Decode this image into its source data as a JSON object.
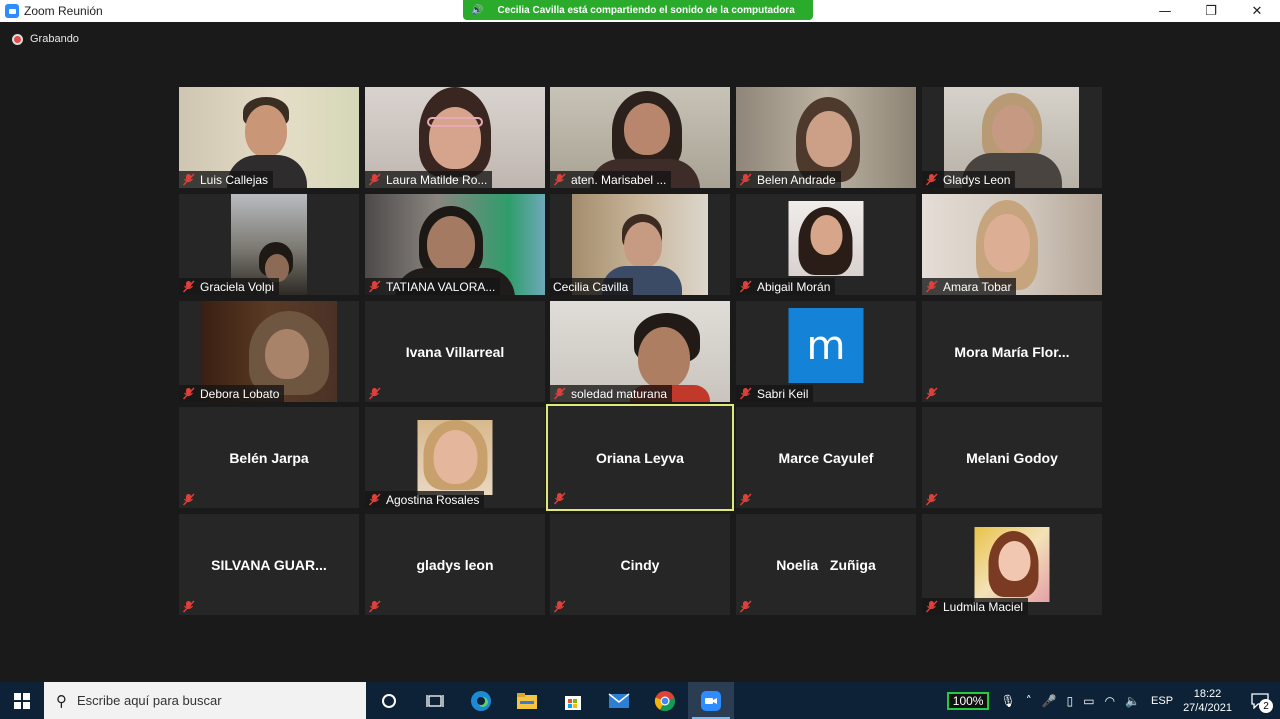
{
  "window": {
    "title": "Zoom Reunión"
  },
  "banner": {
    "text": "Cecilia Cavilla está compartiendo el sonido de la computadora"
  },
  "recording": {
    "label": "Grabando"
  },
  "participants": [
    {
      "name": "Luis Callejas",
      "video": true,
      "muted": true
    },
    {
      "name": "Laura Matilde Ro...",
      "video": true,
      "muted": true
    },
    {
      "name": "aten. Marisabel ...",
      "video": true,
      "muted": true
    },
    {
      "name": "Belen Andrade",
      "video": true,
      "muted": true
    },
    {
      "name": "Gladys Leon",
      "video": true,
      "muted": true
    },
    {
      "name": "Graciela Volpi",
      "video": true,
      "muted": true
    },
    {
      "name": "TATIANA VALORA...",
      "video": true,
      "muted": true
    },
    {
      "name": "Cecilia Cavilla",
      "video": true,
      "muted": false
    },
    {
      "name": "Abigail Morán",
      "video": false,
      "muted": true,
      "avatar": "photo"
    },
    {
      "name": "Amara Tobar",
      "video": true,
      "muted": true
    },
    {
      "name": "Debora Lobato",
      "video": true,
      "muted": true
    },
    {
      "name": "Ivana Villarreal",
      "video": false,
      "muted": true
    },
    {
      "name": "soledad maturana",
      "video": true,
      "muted": true
    },
    {
      "name": "Sabri Keil",
      "video": false,
      "muted": true,
      "avatar": "letter",
      "letter": "m"
    },
    {
      "name": "Mora  María Flor...",
      "video": false,
      "muted": true
    },
    {
      "name": "Belén Jarpa",
      "video": false,
      "muted": true
    },
    {
      "name": "Agostina Rosales",
      "video": false,
      "muted": true,
      "avatar": "photo"
    },
    {
      "name": "Oriana Leyva",
      "video": false,
      "muted": true,
      "active_speaker": true
    },
    {
      "name": "Marce Cayulef",
      "video": false,
      "muted": true
    },
    {
      "name": "Melani Godoy",
      "video": false,
      "muted": true
    },
    {
      "name": "SILVANA GUAR...",
      "video": false,
      "muted": true
    },
    {
      "name": "gladys leon",
      "video": false,
      "muted": true
    },
    {
      "name": "Cindy",
      "video": false,
      "muted": true
    },
    {
      "name": "Noelia   Zuñiga",
      "video": false,
      "muted": true
    },
    {
      "name": "Ludmila Maciel",
      "video": false,
      "muted": true,
      "avatar": "photo"
    }
  ],
  "taskbar": {
    "search_placeholder": "Escribe aquí para buscar",
    "battery": "100%",
    "language": "ESP",
    "time": "18:22",
    "date": "27/4/2021",
    "notifications": "2"
  },
  "colors": {
    "banner_green": "#2bab2b",
    "active_speaker_border": "#e1e87a",
    "muted_red": "#e0403a",
    "zoom_blue": "#2d8cff",
    "letter_avatar_blue": "#1483d7"
  }
}
